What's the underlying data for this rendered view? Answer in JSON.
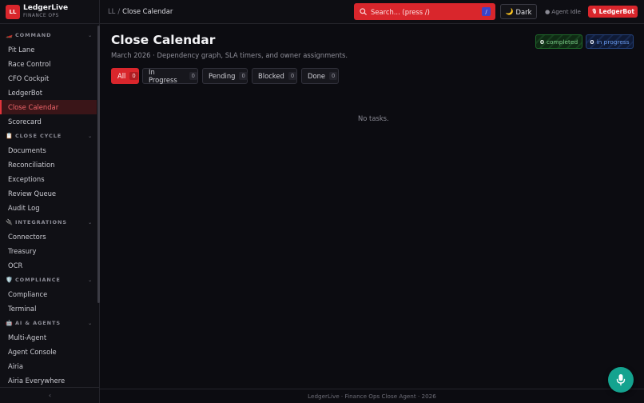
{
  "brand": {
    "logo": "LL",
    "name": "LedgerLive",
    "subtitle": "FINANCE OPS"
  },
  "sidebar": {
    "sections": [
      {
        "icon": "race-car-icon",
        "glyph": "🏎️",
        "title": "COMMAND",
        "items": [
          "Pit Lane",
          "Race Control",
          "CFO Cockpit",
          "LedgerBot",
          "Close Calendar",
          "Scorecard"
        ]
      },
      {
        "icon": "clipboard-icon",
        "glyph": "📋",
        "title": "CLOSE CYCLE",
        "items": [
          "Documents",
          "Reconciliation",
          "Exceptions",
          "Review Queue",
          "Audit Log"
        ]
      },
      {
        "icon": "plug-icon",
        "glyph": "🔌",
        "title": "INTEGRATIONS",
        "items": [
          "Connectors",
          "Treasury",
          "OCR"
        ]
      },
      {
        "icon": "shield-icon",
        "glyph": "🛡️",
        "title": "COMPLIANCE",
        "items": [
          "Compliance",
          "Terminal"
        ]
      },
      {
        "icon": "robot-icon",
        "glyph": "🤖",
        "title": "AI & AGENTS",
        "items": [
          "Multi-Agent",
          "Agent Console",
          "Airia",
          "Airia Everywhere"
        ]
      }
    ],
    "active_item": "Close Calendar",
    "collapse_glyph": "‹"
  },
  "topbar": {
    "breadcrumb_root": "LL",
    "breadcrumb_sep": "/",
    "breadcrumb_current": "Close Calendar",
    "search_placeholder": "Search... (press /)",
    "search_shortcut": "/",
    "theme_label": "Dark",
    "theme_glyph": "🌙",
    "agent_status": "Agent Idle",
    "agent_dot": "●",
    "ledgerbot_label": "LedgerBot",
    "ledgerbot_glyph": "🎙"
  },
  "main": {
    "title": "Close Calendar",
    "subtitle": "March 2026 · Dependency graph, SLA timers, and owner assignments.",
    "badges": {
      "completed": {
        "count": "0",
        "label": "completed"
      },
      "in_progress": {
        "count": "0",
        "label": "in progress"
      }
    },
    "filters": [
      {
        "label": "All",
        "count": "0"
      },
      {
        "label": "In Progress",
        "count": "0"
      },
      {
        "label": "Pending",
        "count": "0"
      },
      {
        "label": "Blocked",
        "count": "0"
      },
      {
        "label": "Done",
        "count": "0"
      }
    ],
    "active_filter": "All",
    "empty_text": "No tasks."
  },
  "footer": {
    "text": "LedgerLive · Finance Ops Close Agent · 2026"
  },
  "colors": {
    "accent": "#d9262c",
    "fab": "#14a38f",
    "completed": "#7ed08a",
    "in_progress": "#6a9cf0"
  }
}
